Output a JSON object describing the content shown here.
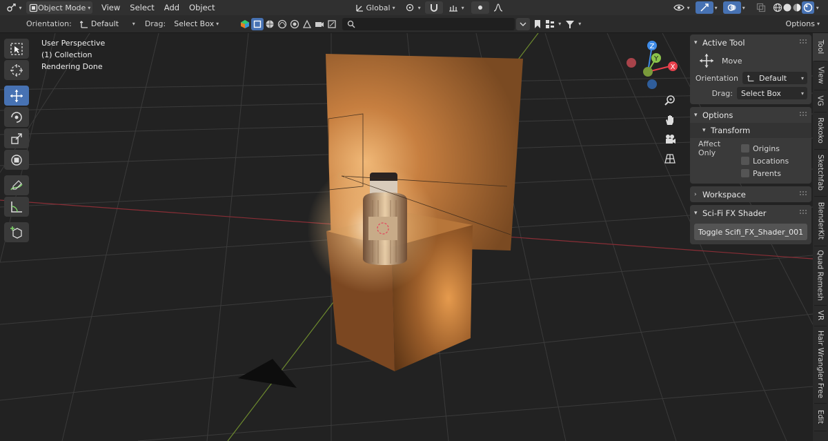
{
  "header": {
    "mode": "Object Mode",
    "menus": [
      "View",
      "Select",
      "Add",
      "Object"
    ],
    "transform_orientation": "Global"
  },
  "toolsettings": {
    "orientation_label": "Orientation:",
    "orientation_value": "Default",
    "drag_label": "Drag:",
    "drag_value": "Select Box",
    "options_label": "Options"
  },
  "viewport": {
    "line1": "User Perspective",
    "line2": "(1) Collection",
    "line3": "Rendering Done"
  },
  "gizmo": {
    "x": "X",
    "y": "Y",
    "z": "Z"
  },
  "npanel": {
    "active_tool": {
      "title": "Active Tool",
      "tool_name": "Move",
      "orientation_label": "Orientation",
      "orientation_value": "Default",
      "drag_label": "Drag:",
      "drag_value": "Select Box"
    },
    "options": {
      "title": "Options",
      "transform_title": "Transform",
      "affect_only_label": "Affect Only",
      "origins": "Origins",
      "locations": "Locations",
      "parents": "Parents"
    },
    "workspace": {
      "title": "Workspace"
    },
    "scifi": {
      "title": "Sci-Fi FX Shader",
      "button": "Toggle Scifi_FX_Shader_001"
    }
  },
  "sidetabs": [
    "Tool",
    "View",
    "VG",
    "Rokoko",
    "Sketchfab",
    "BlenderKit",
    "Quad Remesh",
    "VR",
    "Hair Wrangler Free",
    "Edit"
  ],
  "colors": {
    "accent": "#4772b3",
    "axis_x": "#e8404c",
    "axis_y": "#8bc34a",
    "axis_z": "#3f8ce8"
  }
}
